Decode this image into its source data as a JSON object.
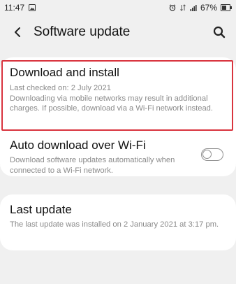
{
  "status_bar": {
    "time": "11:47",
    "battery": "67%"
  },
  "header": {
    "title": "Software update"
  },
  "download": {
    "title": "Download and install",
    "last_checked": "Last checked on: 2 July 2021",
    "note": "Downloading via mobile networks may result in additional charges. If possible, download via a Wi-Fi network instead."
  },
  "auto_download": {
    "title": "Auto download over Wi-Fi",
    "description": "Download software updates automatically when connected to a Wi-Fi network.",
    "enabled": false
  },
  "last_update": {
    "title": "Last update",
    "description": "The last update was installed on 2 January 2021 at 3:17 pm."
  },
  "colors": {
    "background": "#f0f0f0",
    "card": "#ffffff",
    "highlight": "#d9343e",
    "secondary_text": "#8a8a8a"
  }
}
